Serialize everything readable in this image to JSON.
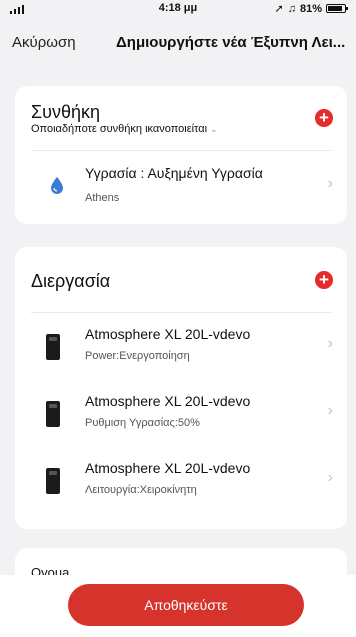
{
  "status_bar": {
    "time": "4:18 μμ",
    "battery": "81%"
  },
  "nav": {
    "cancel": "Ακύρωση",
    "title": "Δημιουργήστε νέα Έξυπνη Λει..."
  },
  "condition": {
    "title": "Συνθήκη",
    "subtitle": "Οποιαδήποτε συνθήκη ικανοποιείται",
    "items": [
      {
        "main": "Υγρασία : Αυξημένη Υγρασία",
        "sub": "Athens",
        "icon": "water-drop-icon"
      }
    ]
  },
  "process": {
    "title": "Διεργασία",
    "items": [
      {
        "main": "Atmosphere XL 20L-vdevo",
        "sub": "Power:Ενεργοποίηση",
        "icon": "dehumidifier-icon"
      },
      {
        "main": "Atmosphere XL 20L-vdevo",
        "sub": "Ρυθμιση Υγρασίας:50%",
        "icon": "dehumidifier-icon"
      },
      {
        "main": "Atmosphere XL 20L-vdevo",
        "sub": "Λειτουργία:Χειροκίνητη",
        "icon": "dehumidifier-icon"
      }
    ]
  },
  "name_section": {
    "title": "Ovoua"
  },
  "save_button": {
    "label": "Αποθηκεύστε"
  },
  "colors": {
    "accent": "#e52b2b",
    "save": "#d6332c",
    "background": "#f2f2f4"
  }
}
